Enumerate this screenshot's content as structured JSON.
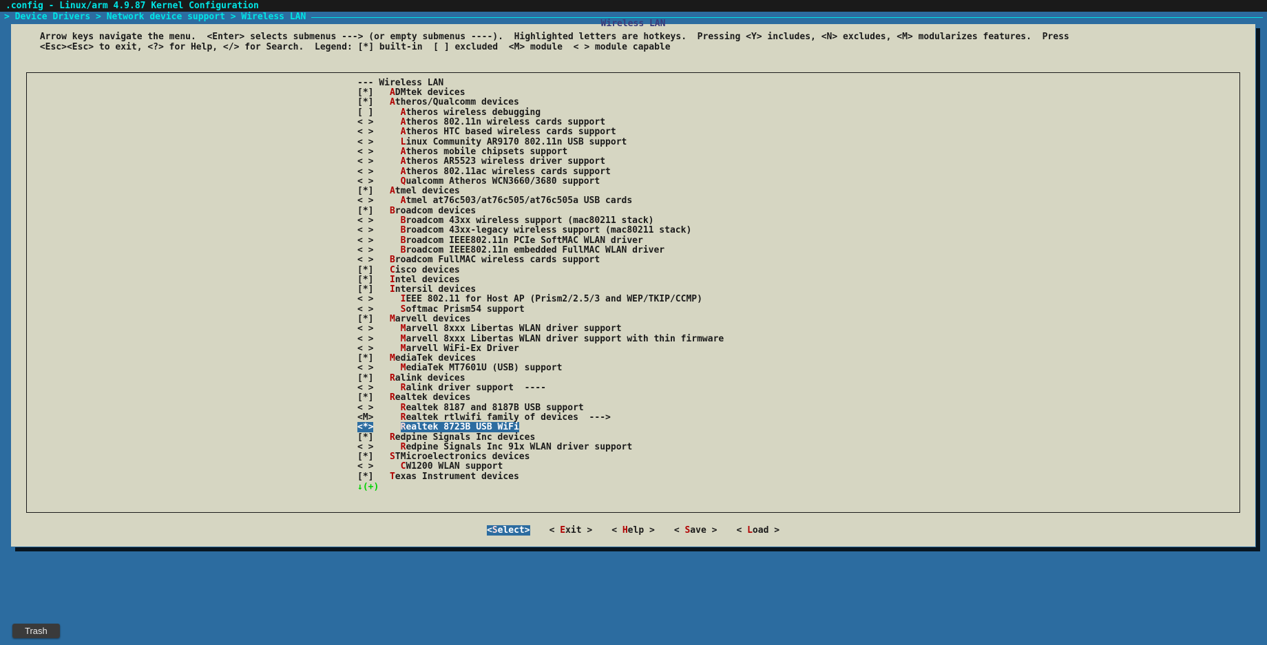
{
  "titlebar": ".config - Linux/arm 4.9.87 Kernel Configuration",
  "breadcrumb": "> Device Drivers > Network device support > Wireless LAN",
  "window_title": "Wireless LAN",
  "instructions": [
    " Arrow keys navigate the menu.  <Enter> selects submenus ---> (or empty submenus ----).  Highlighted letters are hotkeys.  Pressing <Y> includes, <N> excludes, <M> modularizes features.  Press",
    " <Esc><Esc> to exit, <?> for Help, </> for Search.  Legend: [*] built-in  [ ] excluded  <M> module  < > module capable"
  ],
  "items": [
    {
      "state": "---",
      "indent": 0,
      "hot": "",
      "label": "Wireless LAN",
      "selected": false
    },
    {
      "state": "[*]",
      "indent": 1,
      "hot": "A",
      "label": "DMtek devices",
      "selected": false
    },
    {
      "state": "[*]",
      "indent": 1,
      "hot": "A",
      "label": "theros/Qualcomm devices",
      "selected": false
    },
    {
      "state": "[ ]",
      "indent": 2,
      "hot": "A",
      "label": "theros wireless debugging",
      "selected": false
    },
    {
      "state": "< >",
      "indent": 2,
      "hot": "A",
      "label": "theros 802.11n wireless cards support",
      "selected": false
    },
    {
      "state": "< >",
      "indent": 2,
      "hot": "A",
      "label": "theros HTC based wireless cards support",
      "selected": false
    },
    {
      "state": "< >",
      "indent": 2,
      "hot": "L",
      "label": "inux Community AR9170 802.11n USB support",
      "selected": false
    },
    {
      "state": "< >",
      "indent": 2,
      "hot": "A",
      "label": "theros mobile chipsets support",
      "selected": false
    },
    {
      "state": "< >",
      "indent": 2,
      "hot": "A",
      "label": "theros AR5523 wireless driver support",
      "selected": false
    },
    {
      "state": "< >",
      "indent": 2,
      "hot": "A",
      "label": "theros 802.11ac wireless cards support",
      "selected": false
    },
    {
      "state": "< >",
      "indent": 2,
      "hot": "Q",
      "label": "ualcomm Atheros WCN3660/3680 support",
      "selected": false
    },
    {
      "state": "[*]",
      "indent": 1,
      "hot": "A",
      "label": "tmel devices",
      "selected": false
    },
    {
      "state": "< >",
      "indent": 2,
      "hot": "A",
      "label": "tmel at76c503/at76c505/at76c505a USB cards",
      "selected": false
    },
    {
      "state": "[*]",
      "indent": 1,
      "hot": "B",
      "label": "roadcom devices",
      "selected": false
    },
    {
      "state": "< >",
      "indent": 2,
      "hot": "B",
      "label": "roadcom 43xx wireless support (mac80211 stack)",
      "selected": false
    },
    {
      "state": "< >",
      "indent": 2,
      "hot": "B",
      "label": "roadcom 43xx-legacy wireless support (mac80211 stack)",
      "selected": false
    },
    {
      "state": "< >",
      "indent": 2,
      "hot": "B",
      "label": "roadcom IEEE802.11n PCIe SoftMAC WLAN driver",
      "selected": false
    },
    {
      "state": "< >",
      "indent": 2,
      "hot": "B",
      "label": "roadcom IEEE802.11n embedded FullMAC WLAN driver",
      "selected": false
    },
    {
      "state": "< >",
      "indent": 1,
      "hot": "B",
      "label": "roadcom FullMAC wireless cards support",
      "selected": false
    },
    {
      "state": "[*]",
      "indent": 1,
      "hot": "C",
      "label": "isco devices",
      "selected": false
    },
    {
      "state": "[*]",
      "indent": 1,
      "hot": "I",
      "label": "ntel devices",
      "selected": false
    },
    {
      "state": "[*]",
      "indent": 1,
      "hot": "I",
      "label": "ntersil devices",
      "selected": false
    },
    {
      "state": "< >",
      "indent": 2,
      "hot": "I",
      "label": "EEE 802.11 for Host AP (Prism2/2.5/3 and WEP/TKIP/CCMP)",
      "selected": false
    },
    {
      "state": "< >",
      "indent": 2,
      "hot": "S",
      "label": "oftmac Prism54 support",
      "selected": false
    },
    {
      "state": "[*]",
      "indent": 1,
      "hot": "M",
      "label": "arvell devices",
      "selected": false
    },
    {
      "state": "< >",
      "indent": 2,
      "hot": "M",
      "label": "arvell 8xxx Libertas WLAN driver support",
      "selected": false
    },
    {
      "state": "< >",
      "indent": 2,
      "hot": "M",
      "label": "arvell 8xxx Libertas WLAN driver support with thin firmware",
      "selected": false
    },
    {
      "state": "< >",
      "indent": 2,
      "hot": "M",
      "label": "arvell WiFi-Ex Driver",
      "selected": false
    },
    {
      "state": "[*]",
      "indent": 1,
      "hot": "M",
      "label": "ediaTek devices",
      "selected": false
    },
    {
      "state": "< >",
      "indent": 2,
      "hot": "M",
      "label": "ediaTek MT7601U (USB) support",
      "selected": false
    },
    {
      "state": "[*]",
      "indent": 1,
      "hot": "R",
      "label": "alink devices",
      "selected": false
    },
    {
      "state": "< >",
      "indent": 2,
      "hot": "R",
      "label": "alink driver support  ----",
      "selected": false
    },
    {
      "state": "[*]",
      "indent": 1,
      "hot": "R",
      "label": "ealtek devices",
      "selected": false
    },
    {
      "state": "< >",
      "indent": 2,
      "hot": "R",
      "label": "ealtek 8187 and 8187B USB support",
      "selected": false
    },
    {
      "state": "<M>",
      "indent": 2,
      "hot": "R",
      "label": "ealtek rtlwifi family of devices  --->",
      "selected": false
    },
    {
      "state": "<*>",
      "indent": 2,
      "hot": "R",
      "label": "ealtek 8723B USB WiFi",
      "selected": true
    },
    {
      "state": "[*]",
      "indent": 1,
      "hot": "R",
      "label": "edpine Signals Inc devices",
      "selected": false
    },
    {
      "state": "< >",
      "indent": 2,
      "hot": "R",
      "label": "edpine Signals Inc 91x WLAN driver support",
      "selected": false
    },
    {
      "state": "[*]",
      "indent": 1,
      "hot": "S",
      "label": "TMicroelectronics devices",
      "selected": false
    },
    {
      "state": "< >",
      "indent": 2,
      "hot": "C",
      "label": "W1200 WLAN support",
      "selected": false
    },
    {
      "state": "[*]",
      "indent": 1,
      "hot": "T",
      "label": "exas Instrument devices",
      "selected": false
    }
  ],
  "scroll_indicator": "↓(+)",
  "buttons": [
    {
      "pre": "<",
      "hot": "S",
      "post": "elect>",
      "active": true
    },
    {
      "pre": "< ",
      "hot": "E",
      "post": "xit >",
      "active": false
    },
    {
      "pre": "< ",
      "hot": "H",
      "post": "elp >",
      "active": false
    },
    {
      "pre": "< ",
      "hot": "S",
      "post": "ave >",
      "active": false
    },
    {
      "pre": "< ",
      "hot": "L",
      "post": "oad >",
      "active": false
    }
  ],
  "taskbar": {
    "trash": "Trash"
  }
}
